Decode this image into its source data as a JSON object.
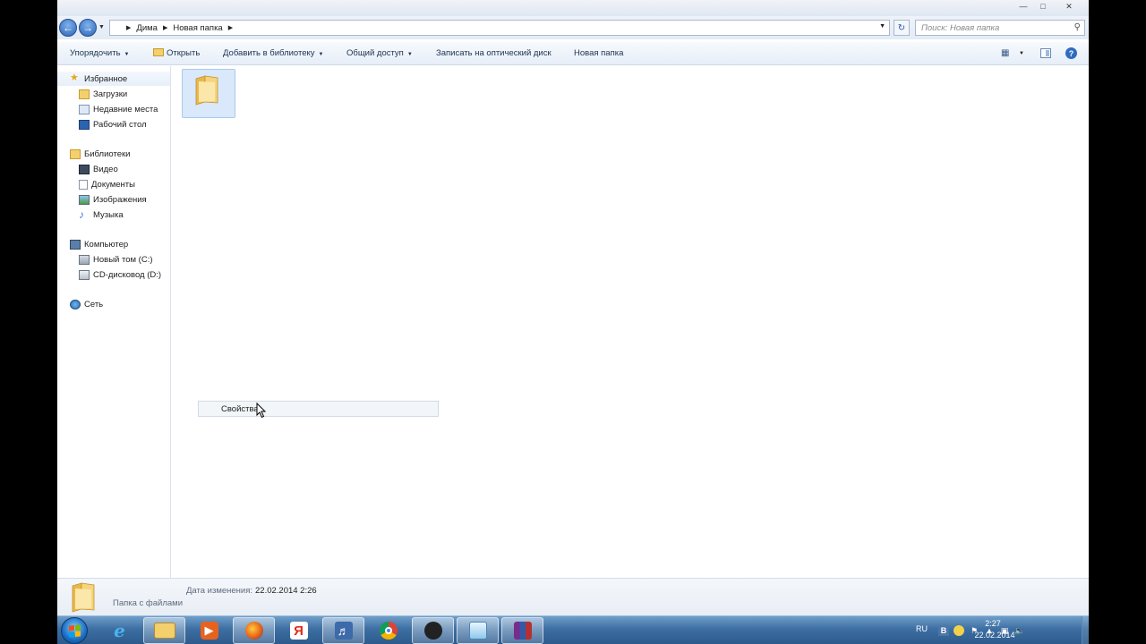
{
  "address": {
    "crumbs": [
      "Дима",
      "Новая папка"
    ]
  },
  "search": {
    "placeholder": "Поиск: Новая папка"
  },
  "toolbar": {
    "organize": "Упорядочить",
    "open": "Открыть",
    "add_library": "Добавить в библиотеку",
    "share": "Общий доступ",
    "burn": "Записать на оптический диск",
    "new_folder": "Новая папка"
  },
  "nav": {
    "favorites": {
      "label": "Избранное",
      "items": [
        "Загрузки",
        "Недавние места",
        "Рабочий стол"
      ]
    },
    "libraries": {
      "label": "Библиотеки",
      "items": [
        "Видео",
        "Документы",
        "Изображения",
        "Музыка"
      ]
    },
    "computer": {
      "label": "Компьютер",
      "items": [
        "Новый том (C:)",
        "CD-дисковод (D:)"
      ]
    },
    "network": {
      "label": "Сеть"
    }
  },
  "context_menu": {
    "properties": "Свойства"
  },
  "details": {
    "date_label": "Дата изменения:",
    "date_value": "22.02.2014 2:26",
    "type": "Папка с файлами"
  },
  "taskbar": {
    "apps": [
      "ie-icon",
      "explorer-icon",
      "media-player-icon",
      "firefox-icon",
      "yandex-icon",
      "audio-icon",
      "chrome-icon",
      "obs-icon",
      "notepad-icon",
      "winrar-icon"
    ],
    "yandex_letter": "Я",
    "lang": "RU",
    "time": "2:27",
    "date": "22.02.2014"
  },
  "colors": {
    "taskbar": "#3e6fa3",
    "selection": "#d9e8fb",
    "folder": "#f3cf6e"
  }
}
